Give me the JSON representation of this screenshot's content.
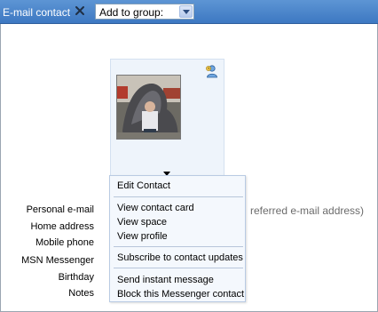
{
  "toolbar": {
    "title": "E-mail contact",
    "close_icon": "close-x-icon",
    "group_select": {
      "selected": "Add to group:",
      "dropdown_icon": "chevron-down-icon"
    }
  },
  "contact_card": {
    "presence_icon": "messenger-buddy-icon",
    "photo_alt": "Contact photo"
  },
  "fields": {
    "personal_email": "Personal e-mail",
    "home_address": "Home address",
    "mobile_phone": "Mobile phone",
    "msn_messenger": "MSN Messenger",
    "birthday": "Birthday",
    "notes": "Notes",
    "preferred_hint": "referred e-mail address)"
  },
  "menu": {
    "items": [
      "Edit Contact",
      "View contact card",
      "View space",
      "View profile",
      "Subscribe to contact updates",
      "Send instant message",
      "Block this Messenger contact"
    ]
  },
  "colors": {
    "toolbar_bg": "#4a86ca",
    "menu_bg": "#f4f8fd",
    "card_bg": "#eef4fb"
  }
}
